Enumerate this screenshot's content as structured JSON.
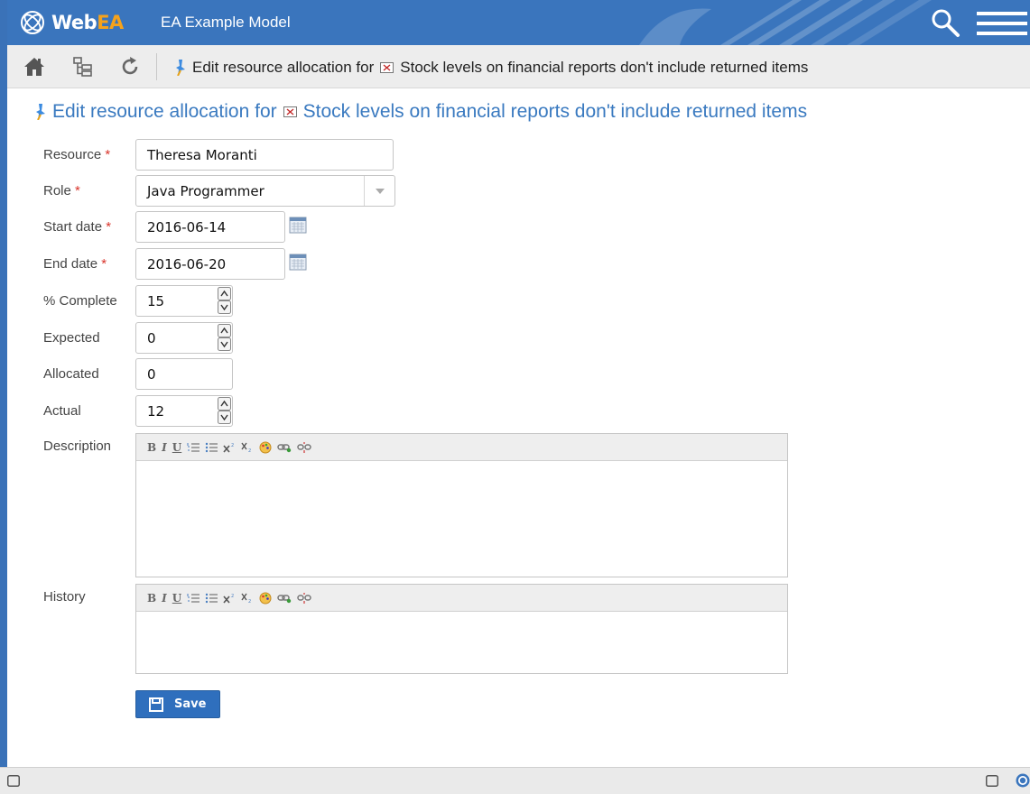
{
  "header": {
    "logo_text_main": "Web",
    "logo_text_accent": "EA",
    "model_title": "EA Example Model"
  },
  "toolbar": {
    "breadcrumb_prefix": "Edit resource allocation for",
    "breadcrumb_element": "Stock levels on financial reports don't include returned items"
  },
  "page": {
    "title_prefix": "Edit resource allocation for",
    "title_element": "Stock levels on financial reports don't include returned items"
  },
  "form": {
    "required_marker": "*",
    "resource": {
      "label": "Resource",
      "value": "Theresa Moranti"
    },
    "role": {
      "label": "Role",
      "value": "Java Programmer"
    },
    "start_date": {
      "label": "Start date",
      "value": "2016-06-14"
    },
    "end_date": {
      "label": "End date",
      "value": "2016-06-20"
    },
    "percent_complete": {
      "label": "% Complete",
      "value": "15"
    },
    "expected": {
      "label": "Expected",
      "value": "0"
    },
    "allocated": {
      "label": "Allocated",
      "value": "0"
    },
    "actual": {
      "label": "Actual",
      "value": "12"
    },
    "description": {
      "label": "Description",
      "value": ""
    },
    "history": {
      "label": "History",
      "value": ""
    },
    "editor_toolbar": [
      "B",
      "I",
      "U"
    ],
    "save_label": "Save"
  },
  "colors": {
    "header_bg": "#3a75bd",
    "accent_orange": "#f5a21c",
    "title_blue": "#3a7ac0",
    "required_red": "#d9342b",
    "save_button": "#2f6fbd"
  },
  "icons": {
    "logo": "webea-logo-icon",
    "search": "search-icon",
    "menu": "hamburger-menu-icon",
    "home": "home-icon",
    "tree": "browser-tree-icon",
    "refresh": "refresh-icon",
    "pin": "pin-icon",
    "element": "change-element-icon",
    "calendar": "calendar-icon",
    "spinner": "spinner-icon",
    "save": "save-icon"
  }
}
